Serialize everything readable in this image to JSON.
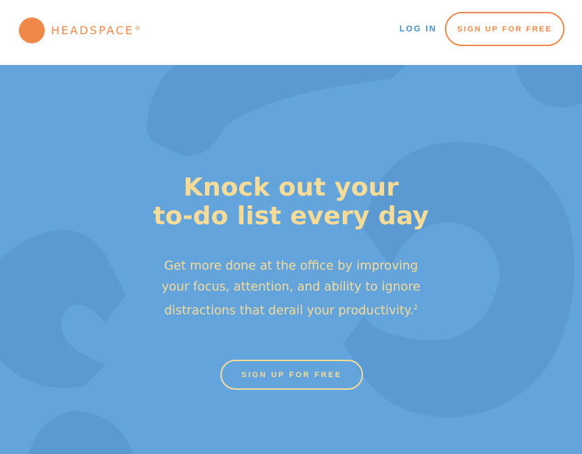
{
  "header": {
    "logo_text": "HEADSPACE",
    "logo_mark": "®",
    "login_label": "LOG IN",
    "signup_label": "SIGN UP FOR FREE"
  },
  "hero": {
    "headline_line1": "Knock out your",
    "headline_line2": "to-do list every day",
    "subtext": "Get more done at the office by improving your focus, attention, and ability to ignore distractions that derail your productivity.",
    "footnote": "2",
    "cta_label": "SIGN UP FOR FREE"
  },
  "colors": {
    "brand_orange": "#f0884a",
    "hero_blue": "#63a4dc",
    "hero_shape": "#5a99d2",
    "hero_text": "#f7dc97",
    "login_blue": "#4a90c8"
  },
  "icons": [
    "logo-dot-icon"
  ]
}
